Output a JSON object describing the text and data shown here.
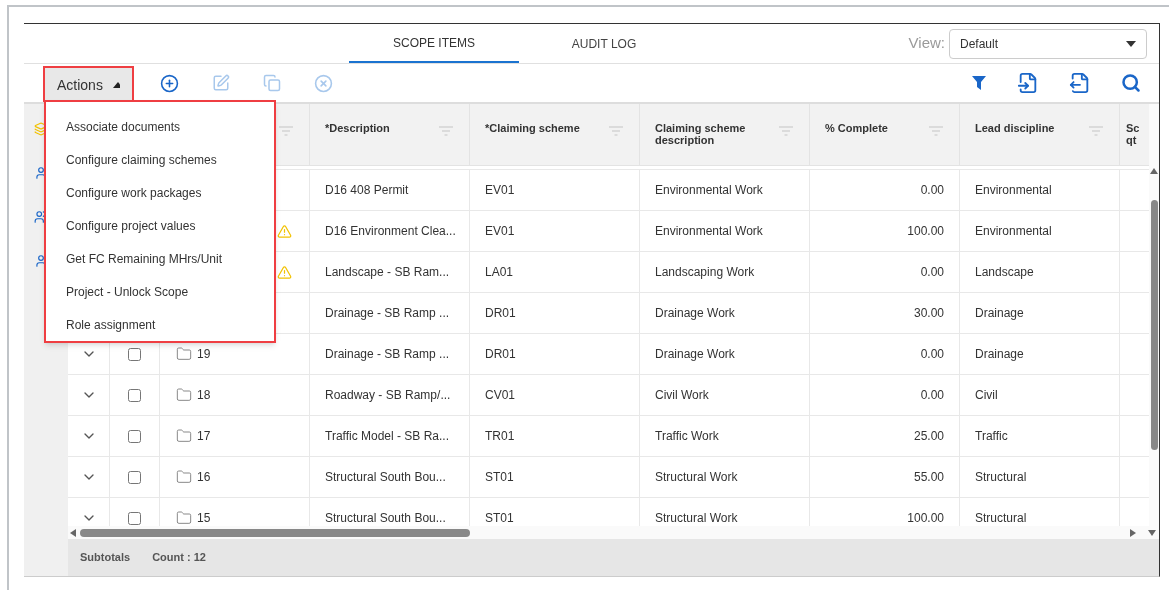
{
  "tabs": [
    {
      "label": "SCOPE ITEMS",
      "selected": true
    },
    {
      "label": "AUDIT LOG",
      "selected": false
    }
  ],
  "view": {
    "label": "View:",
    "value": "Default"
  },
  "actions": {
    "label": "Actions",
    "expanded": true
  },
  "menu_items": [
    "Associate documents",
    "Configure claiming schemes",
    "Configure work packages",
    "Configure project values",
    "Get FC Remaining MHrs/Unit",
    "Project - Unlock Scope",
    "Role assignment"
  ],
  "columns": [
    {},
    {
      "label": "*Description"
    },
    {
      "label": "*Claiming scheme"
    },
    {
      "label": "Claiming scheme description"
    },
    {
      "label": "% Complete"
    },
    {
      "label": "Lead discipline"
    },
    {
      "label": "Sc qt"
    }
  ],
  "rows": [
    {
      "warning": false,
      "description": "D16 408 Permit",
      "scheme": "EV01",
      "scheme_description": "Environmental Work",
      "complete": "0.00",
      "discipline": "Environmental"
    },
    {
      "warning": true,
      "description": "D16 Environment Clea...",
      "scheme": "EV01",
      "scheme_description": "Environmental Work",
      "complete": "100.00",
      "discipline": "Environmental"
    },
    {
      "warning": true,
      "description": "Landscape - SB Ram...",
      "scheme": "LA01",
      "scheme_description": "Landscaping Work",
      "complete": "0.00",
      "discipline": "Landscape"
    },
    {
      "warning": false,
      "description": "Drainage - SB Ramp ...",
      "scheme": "DR01",
      "scheme_description": "Drainage Work",
      "complete": "30.00",
      "discipline": "Drainage"
    },
    {
      "id": "19",
      "checked": false,
      "warning": false,
      "description": "Drainage - SB Ramp ...",
      "scheme": "DR01",
      "scheme_description": "Drainage Work",
      "complete": "0.00",
      "discipline": "Drainage"
    },
    {
      "id": "18",
      "checked": false,
      "warning": false,
      "description": "Roadway - SB Ramp/...",
      "scheme": "CV01",
      "scheme_description": "Civil Work",
      "complete": "0.00",
      "discipline": "Civil"
    },
    {
      "id": "17",
      "checked": false,
      "warning": false,
      "description": "Traffic Model - SB Ra...",
      "scheme": "TR01",
      "scheme_description": "Traffic Work",
      "complete": "25.00",
      "discipline": "Traffic"
    },
    {
      "id": "16",
      "checked": false,
      "warning": false,
      "description": "Structural South Bou...",
      "scheme": "ST01",
      "scheme_description": "Structural Work",
      "complete": "55.00",
      "discipline": "Structural"
    },
    {
      "id": "15",
      "checked": false,
      "warning": false,
      "description": "Structural South Bou...",
      "scheme": "ST01",
      "scheme_description": "Structural Work",
      "complete": "100.00",
      "discipline": "Structural"
    }
  ],
  "subtotals": {
    "label": "Subtotals",
    "count": "Count : 12"
  }
}
